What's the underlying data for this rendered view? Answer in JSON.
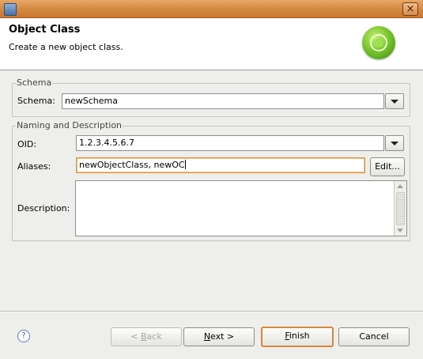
{
  "window": {
    "close_glyph": "×"
  },
  "banner": {
    "title": "Object Class",
    "description": "Create a new object class."
  },
  "schema_group": {
    "legend": "Schema",
    "schema_label": "Schema:",
    "schema_value": "newSchema"
  },
  "naming_group": {
    "legend": "Naming and Description",
    "oid_label": "OID:",
    "oid_value": "1.2.3.4.5.6.7",
    "aliases_label": "Aliases:",
    "aliases_value": "newObjectClass, newOC",
    "edit_label": "Edit...",
    "description_label": "Description:",
    "description_value": ""
  },
  "footer": {
    "help_glyph": "?",
    "back_prefix": "< ",
    "back_mnemonic": "B",
    "back_rest": "ack",
    "next_mnemonic": "N",
    "next_rest": "ext >",
    "finish_mnemonic": "F",
    "finish_rest": "inish",
    "cancel_label": "Cancel"
  },
  "colors": {
    "titlebar": "#d78d47",
    "focus_border": "#e38d33",
    "default_button_border": "#d9873a",
    "logo_green": "#7ac52d"
  },
  "icons": [
    "app-icon",
    "close-icon",
    "object-class-logo-icon",
    "help-icon",
    "chevron-down-icon"
  ]
}
